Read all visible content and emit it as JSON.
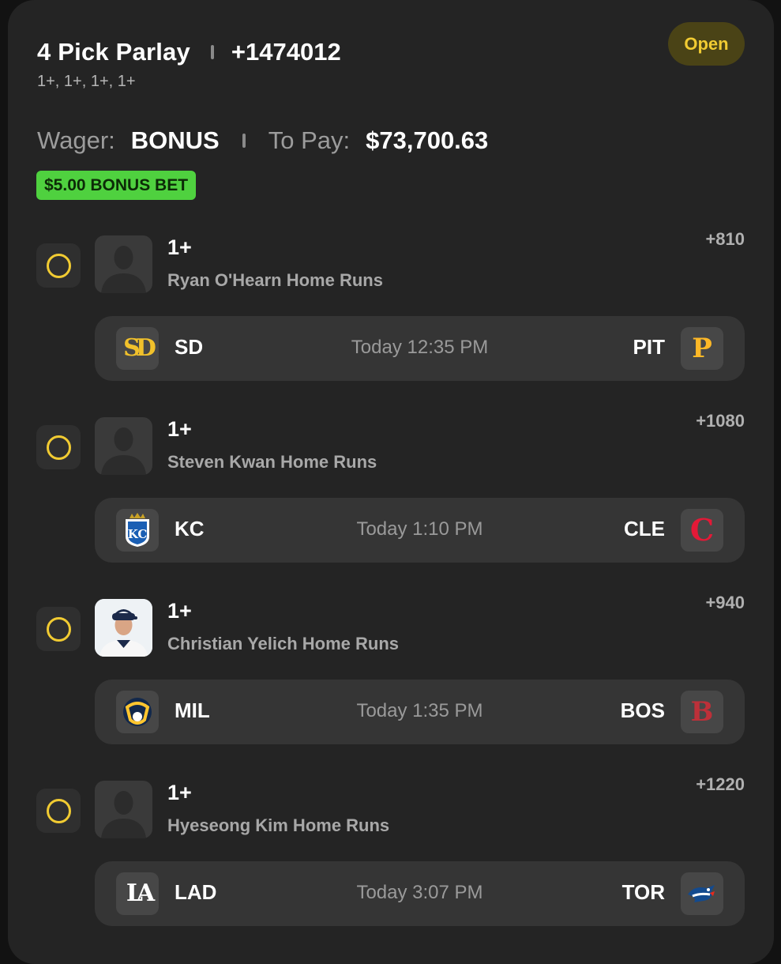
{
  "parlay": {
    "title": "4 Pick Parlay",
    "odds": "+1474012",
    "legs_summary": "1+, 1+, 1+, 1+",
    "status": "Open",
    "wager_label": "Wager:",
    "wager_value": "BONUS",
    "to_pay_label": "To Pay:",
    "to_pay_value": "$73,700.63",
    "bonus_badge": "$5.00 BONUS BET"
  },
  "legs": [
    {
      "line": "1+",
      "prop": "Ryan O'Hearn Home Runs",
      "odds": "+810",
      "avatar": "player-silhouette",
      "away": {
        "abbr": "SD",
        "logo": "sd-logo",
        "color": "#f1c12b"
      },
      "time": "Today 12:35 PM",
      "home": {
        "abbr": "PIT",
        "logo": "pit-logo",
        "color": "#fdb827"
      }
    },
    {
      "line": "1+",
      "prop": "Steven Kwan Home Runs",
      "odds": "+1080",
      "avatar": "player-silhouette",
      "away": {
        "abbr": "KC",
        "logo": "kc-logo",
        "color": "#1a5fb4"
      },
      "time": "Today 1:10 PM",
      "home": {
        "abbr": "CLE",
        "logo": "cle-logo",
        "color": "#e31937"
      }
    },
    {
      "line": "1+",
      "prop": "Christian Yelich Home Runs",
      "odds": "+940",
      "avatar": "player-photo",
      "away": {
        "abbr": "MIL",
        "logo": "mil-logo",
        "color": "#ffc52f"
      },
      "time": "Today 1:35 PM",
      "home": {
        "abbr": "BOS",
        "logo": "bos-logo",
        "color": "#bd3039"
      }
    },
    {
      "line": "1+",
      "prop": "Hyeseong Kim Home Runs",
      "odds": "+1220",
      "avatar": "player-silhouette",
      "away": {
        "abbr": "LAD",
        "logo": "lad-logo",
        "color": "#ffffff"
      },
      "time": "Today 3:07 PM",
      "home": {
        "abbr": "TOR",
        "logo": "tor-logo",
        "color": "#134a8e"
      }
    }
  ],
  "colors": {
    "accent_yellow": "#f1cb32",
    "bonus_green": "#4fd13f",
    "card_bg": "#242424"
  }
}
